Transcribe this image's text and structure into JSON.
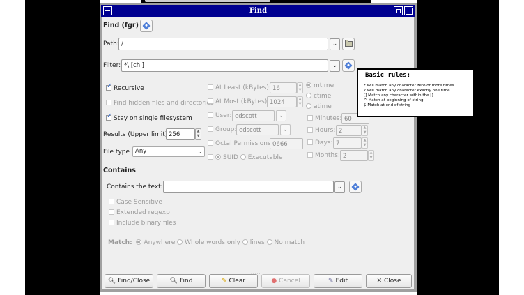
{
  "window": {
    "title": "Find"
  },
  "header": {
    "label": "Find (fgr)"
  },
  "path": {
    "label": "Path:",
    "value": "/"
  },
  "filter": {
    "label": "Filter:",
    "value": "*\\.[chi]"
  },
  "options": {
    "recursive": "Recursive",
    "hidden": "Find hidden files and directories",
    "single_fs": "Stay on single filesystem",
    "results_label": "Results (Upper limit):",
    "results_value": "256",
    "filetype_label": "File type :",
    "filetype_value": "Any"
  },
  "size": {
    "at_least": "At Least (kBytes):",
    "at_least_value": "16",
    "at_most": "At Most (kBytes):",
    "at_most_value": "1024",
    "user": "User:",
    "user_value": "edscott",
    "group": "Group:",
    "group_value": "edscott",
    "octal": "Octal Permissions:",
    "octal_value": "0666",
    "suid": "SUID",
    "executable": "Executable"
  },
  "time": {
    "mtime": "mtime",
    "ctime": "ctime",
    "atime": "atime",
    "minutes": "Minutes:",
    "minutes_value": "60",
    "hours": "Hours:",
    "hours_value": "2",
    "days": "Days:",
    "days_value": "7",
    "months": "Months:",
    "months_value": "2"
  },
  "contains": {
    "heading": "Contains",
    "label": "Contains the text:",
    "value": "",
    "case": "Case Sensitive",
    "regexp": "Extended regexp",
    "binary": "Include binary files",
    "match_label": "Match:",
    "anywhere": "Anywhere",
    "whole": "Whole words only",
    "lines": "lines",
    "nomatch": "No match"
  },
  "buttons": {
    "find_close": "Find/Close",
    "find": "Find",
    "clear": "Clear",
    "cancel": "Cancel",
    "edit": "Edit",
    "close": "Close"
  },
  "tooltip": {
    "title": "Basic rules:",
    "lines": [
      "* Will match any character zero or more times.",
      "? Will match any character exactly one time",
      "[] Match any character within the []",
      "^ Match at beginning of string",
      "$ Match at end of string"
    ]
  }
}
